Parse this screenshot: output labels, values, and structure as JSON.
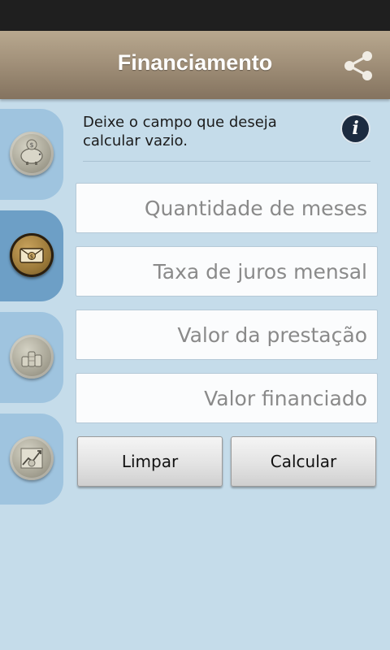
{
  "app_bar": {
    "title": "Financiamento",
    "share_icon": "share-icon"
  },
  "side_tabs": [
    {
      "icon": "piggy-bank-icon",
      "active": false
    },
    {
      "icon": "money-envelope-icon",
      "active": true
    },
    {
      "icon": "coin-stacks-icon",
      "active": false
    },
    {
      "icon": "growth-chart-icon",
      "active": false
    }
  ],
  "form": {
    "instruction": "Deixe o campo que deseja calcular vazio.",
    "info_icon": "info-icon",
    "fields": [
      {
        "placeholder": "Quantidade de meses",
        "value": ""
      },
      {
        "placeholder": "Taxa de juros mensal",
        "value": ""
      },
      {
        "placeholder": "Valor da prestação",
        "value": ""
      },
      {
        "placeholder": "Valor financiado",
        "value": ""
      }
    ],
    "buttons": {
      "clear_label": "Limpar",
      "calculate_label": "Calcular"
    }
  },
  "colors": {
    "background": "#c5dcea",
    "app_bar": "#a2917a",
    "tab": "#9fc4df",
    "tab_active": "#6d9fc6"
  }
}
